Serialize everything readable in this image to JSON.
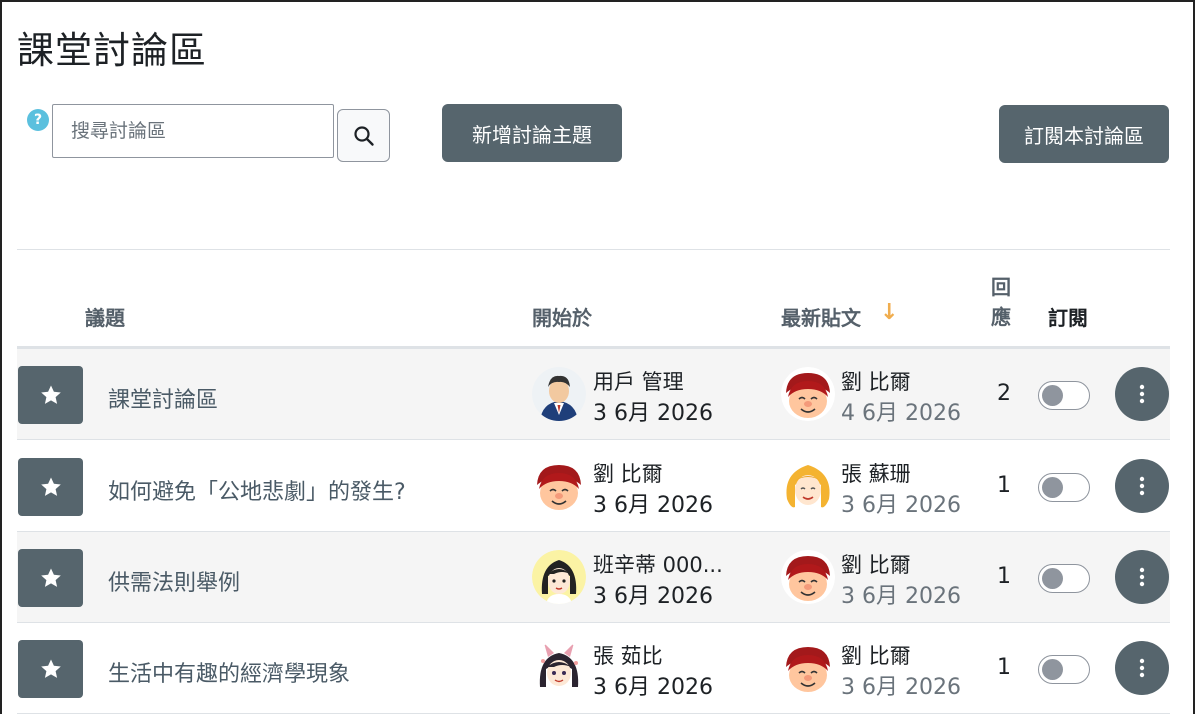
{
  "page": {
    "title": "課堂討論區"
  },
  "toolbar": {
    "help_icon": "?",
    "search_placeholder": "搜尋討論區",
    "new_topic_label": "新增討論主題",
    "subscribe_label": "訂閱本討論區"
  },
  "table": {
    "headers": {
      "topic": "議題",
      "started_by": "開始於",
      "latest_post": "最新貼文",
      "sort_arrow": "↓",
      "replies": "回應",
      "subscribe": "訂閱"
    },
    "rows": [
      {
        "topic": "課堂討論區",
        "started_name": "用戶 管理",
        "started_date": "3 6月 2026",
        "latest_name": "劉 比爾",
        "latest_date": "4 6月 2026",
        "replies": "2"
      },
      {
        "topic": "如何避免「公地悲劇」的發生?",
        "started_name": "劉 比爾",
        "started_date": "3 6月 2026",
        "latest_name": "張 蘇珊",
        "latest_date": "3 6月 2026",
        "replies": "1"
      },
      {
        "topic": "供需法則舉例",
        "started_name": "班辛蒂 000...",
        "started_date": "3 6月 2026",
        "latest_name": "劉 比爾",
        "latest_date": "3 6月 2026",
        "replies": "1"
      },
      {
        "topic": "生活中有趣的經濟學現象",
        "started_name": "張 茹比",
        "started_date": "3 6月 2026",
        "latest_name": "劉 比爾",
        "latest_date": "3 6月 2026",
        "replies": "1"
      }
    ]
  },
  "colors": {
    "button": "#56656d",
    "accent_sort": "#f0ad4e",
    "help": "#5bc0de"
  }
}
